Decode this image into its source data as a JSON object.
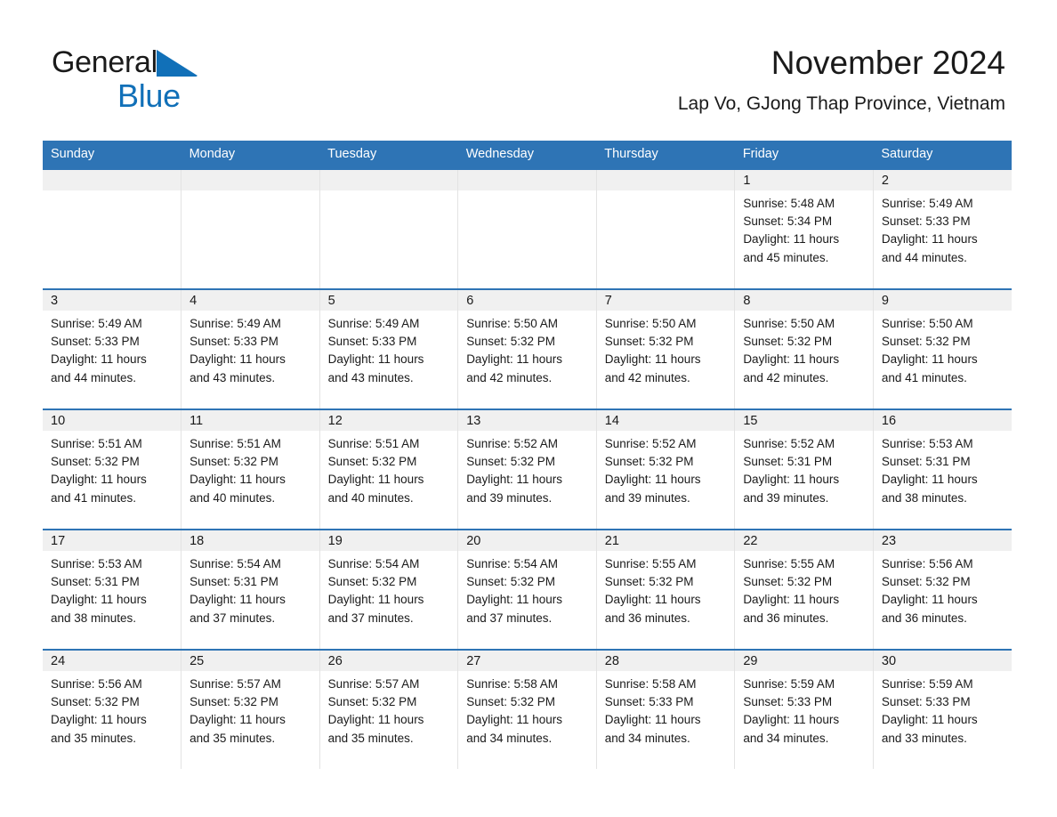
{
  "brand": {
    "name_part1": "General",
    "name_part2": "Blue",
    "triangle_color": "#1170b8",
    "text_color": "#1a1a1a"
  },
  "header": {
    "title": "November 2024",
    "location": "Lap Vo, GJong Thap Province, Vietnam"
  },
  "colors": {
    "header_blue": "#2e74b5",
    "row_rule_blue": "#2e74b5",
    "daynum_band": "#f0f0f0",
    "page_background": "#ffffff",
    "text": "#1a1a1a",
    "column_divider": "#e3e3e3"
  },
  "calendar": {
    "weekday_headers": [
      "Sunday",
      "Monday",
      "Tuesday",
      "Wednesday",
      "Thursday",
      "Friday",
      "Saturday"
    ],
    "labels": {
      "sunrise_prefix": "Sunrise:",
      "sunset_prefix": "Sunset:",
      "daylight_prefix": "Daylight:"
    },
    "weeks": [
      [
        {
          "day": "",
          "empty": true,
          "line1": "",
          "line2": "",
          "line3": "",
          "line4": ""
        },
        {
          "day": "",
          "empty": true,
          "line1": "",
          "line2": "",
          "line3": "",
          "line4": ""
        },
        {
          "day": "",
          "empty": true,
          "line1": "",
          "line2": "",
          "line3": "",
          "line4": ""
        },
        {
          "day": "",
          "empty": true,
          "line1": "",
          "line2": "",
          "line3": "",
          "line4": ""
        },
        {
          "day": "",
          "empty": true,
          "line1": "",
          "line2": "",
          "line3": "",
          "line4": ""
        },
        {
          "day": "1",
          "empty": false,
          "line1": "Sunrise: 5:48 AM",
          "line2": "Sunset: 5:34 PM",
          "line3": "Daylight: 11 hours",
          "line4": "and 45 minutes."
        },
        {
          "day": "2",
          "empty": false,
          "line1": "Sunrise: 5:49 AM",
          "line2": "Sunset: 5:33 PM",
          "line3": "Daylight: 11 hours",
          "line4": "and 44 minutes."
        }
      ],
      [
        {
          "day": "3",
          "empty": false,
          "line1": "Sunrise: 5:49 AM",
          "line2": "Sunset: 5:33 PM",
          "line3": "Daylight: 11 hours",
          "line4": "and 44 minutes."
        },
        {
          "day": "4",
          "empty": false,
          "line1": "Sunrise: 5:49 AM",
          "line2": "Sunset: 5:33 PM",
          "line3": "Daylight: 11 hours",
          "line4": "and 43 minutes."
        },
        {
          "day": "5",
          "empty": false,
          "line1": "Sunrise: 5:49 AM",
          "line2": "Sunset: 5:33 PM",
          "line3": "Daylight: 11 hours",
          "line4": "and 43 minutes."
        },
        {
          "day": "6",
          "empty": false,
          "line1": "Sunrise: 5:50 AM",
          "line2": "Sunset: 5:32 PM",
          "line3": "Daylight: 11 hours",
          "line4": "and 42 minutes."
        },
        {
          "day": "7",
          "empty": false,
          "line1": "Sunrise: 5:50 AM",
          "line2": "Sunset: 5:32 PM",
          "line3": "Daylight: 11 hours",
          "line4": "and 42 minutes."
        },
        {
          "day": "8",
          "empty": false,
          "line1": "Sunrise: 5:50 AM",
          "line2": "Sunset: 5:32 PM",
          "line3": "Daylight: 11 hours",
          "line4": "and 42 minutes."
        },
        {
          "day": "9",
          "empty": false,
          "line1": "Sunrise: 5:50 AM",
          "line2": "Sunset: 5:32 PM",
          "line3": "Daylight: 11 hours",
          "line4": "and 41 minutes."
        }
      ],
      [
        {
          "day": "10",
          "empty": false,
          "line1": "Sunrise: 5:51 AM",
          "line2": "Sunset: 5:32 PM",
          "line3": "Daylight: 11 hours",
          "line4": "and 41 minutes."
        },
        {
          "day": "11",
          "empty": false,
          "line1": "Sunrise: 5:51 AM",
          "line2": "Sunset: 5:32 PM",
          "line3": "Daylight: 11 hours",
          "line4": "and 40 minutes."
        },
        {
          "day": "12",
          "empty": false,
          "line1": "Sunrise: 5:51 AM",
          "line2": "Sunset: 5:32 PM",
          "line3": "Daylight: 11 hours",
          "line4": "and 40 minutes."
        },
        {
          "day": "13",
          "empty": false,
          "line1": "Sunrise: 5:52 AM",
          "line2": "Sunset: 5:32 PM",
          "line3": "Daylight: 11 hours",
          "line4": "and 39 minutes."
        },
        {
          "day": "14",
          "empty": false,
          "line1": "Sunrise: 5:52 AM",
          "line2": "Sunset: 5:32 PM",
          "line3": "Daylight: 11 hours",
          "line4": "and 39 minutes."
        },
        {
          "day": "15",
          "empty": false,
          "line1": "Sunrise: 5:52 AM",
          "line2": "Sunset: 5:31 PM",
          "line3": "Daylight: 11 hours",
          "line4": "and 39 minutes."
        },
        {
          "day": "16",
          "empty": false,
          "line1": "Sunrise: 5:53 AM",
          "line2": "Sunset: 5:31 PM",
          "line3": "Daylight: 11 hours",
          "line4": "and 38 minutes."
        }
      ],
      [
        {
          "day": "17",
          "empty": false,
          "line1": "Sunrise: 5:53 AM",
          "line2": "Sunset: 5:31 PM",
          "line3": "Daylight: 11 hours",
          "line4": "and 38 minutes."
        },
        {
          "day": "18",
          "empty": false,
          "line1": "Sunrise: 5:54 AM",
          "line2": "Sunset: 5:31 PM",
          "line3": "Daylight: 11 hours",
          "line4": "and 37 minutes."
        },
        {
          "day": "19",
          "empty": false,
          "line1": "Sunrise: 5:54 AM",
          "line2": "Sunset: 5:32 PM",
          "line3": "Daylight: 11 hours",
          "line4": "and 37 minutes."
        },
        {
          "day": "20",
          "empty": false,
          "line1": "Sunrise: 5:54 AM",
          "line2": "Sunset: 5:32 PM",
          "line3": "Daylight: 11 hours",
          "line4": "and 37 minutes."
        },
        {
          "day": "21",
          "empty": false,
          "line1": "Sunrise: 5:55 AM",
          "line2": "Sunset: 5:32 PM",
          "line3": "Daylight: 11 hours",
          "line4": "and 36 minutes."
        },
        {
          "day": "22",
          "empty": false,
          "line1": "Sunrise: 5:55 AM",
          "line2": "Sunset: 5:32 PM",
          "line3": "Daylight: 11 hours",
          "line4": "and 36 minutes."
        },
        {
          "day": "23",
          "empty": false,
          "line1": "Sunrise: 5:56 AM",
          "line2": "Sunset: 5:32 PM",
          "line3": "Daylight: 11 hours",
          "line4": "and 36 minutes."
        }
      ],
      [
        {
          "day": "24",
          "empty": false,
          "line1": "Sunrise: 5:56 AM",
          "line2": "Sunset: 5:32 PM",
          "line3": "Daylight: 11 hours",
          "line4": "and 35 minutes."
        },
        {
          "day": "25",
          "empty": false,
          "line1": "Sunrise: 5:57 AM",
          "line2": "Sunset: 5:32 PM",
          "line3": "Daylight: 11 hours",
          "line4": "and 35 minutes."
        },
        {
          "day": "26",
          "empty": false,
          "line1": "Sunrise: 5:57 AM",
          "line2": "Sunset: 5:32 PM",
          "line3": "Daylight: 11 hours",
          "line4": "and 35 minutes."
        },
        {
          "day": "27",
          "empty": false,
          "line1": "Sunrise: 5:58 AM",
          "line2": "Sunset: 5:32 PM",
          "line3": "Daylight: 11 hours",
          "line4": "and 34 minutes."
        },
        {
          "day": "28",
          "empty": false,
          "line1": "Sunrise: 5:58 AM",
          "line2": "Sunset: 5:33 PM",
          "line3": "Daylight: 11 hours",
          "line4": "and 34 minutes."
        },
        {
          "day": "29",
          "empty": false,
          "line1": "Sunrise: 5:59 AM",
          "line2": "Sunset: 5:33 PM",
          "line3": "Daylight: 11 hours",
          "line4": "and 34 minutes."
        },
        {
          "day": "30",
          "empty": false,
          "line1": "Sunrise: 5:59 AM",
          "line2": "Sunset: 5:33 PM",
          "line3": "Daylight: 11 hours",
          "line4": "and 33 minutes."
        }
      ]
    ]
  }
}
